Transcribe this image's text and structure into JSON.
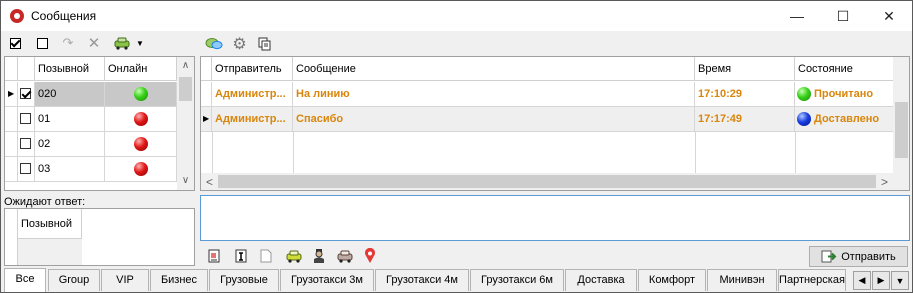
{
  "window": {
    "title": "Сообщения"
  },
  "left_toolbar": {
    "icons": [
      "check-all-icon",
      "uncheck-all-icon",
      "redo-icon",
      "delete-icon",
      "car-icon",
      "dropdown-icon"
    ]
  },
  "drivers": {
    "columns": [
      "Позывной",
      "Онлайн"
    ],
    "rows": [
      {
        "callsign": "020",
        "checked": true,
        "online": "green",
        "selected": true
      },
      {
        "callsign": "01",
        "checked": false,
        "online": "red"
      },
      {
        "callsign": "02",
        "checked": false,
        "online": "red"
      },
      {
        "callsign": "03",
        "checked": false,
        "online": "red"
      }
    ]
  },
  "awaiting": {
    "label": "Ожидают ответ:",
    "column": "Позывной"
  },
  "right_toolbar": {
    "icons": [
      "chat-icon",
      "gear-icon",
      "copy-icon"
    ]
  },
  "messages": {
    "columns": [
      "Отправитель",
      "Сообщение",
      "Время",
      "Состояние"
    ],
    "rows": [
      {
        "sender": "Администр...",
        "message": "На линию",
        "time": "17:10:29",
        "status": "Прочитано",
        "status_color": "green"
      },
      {
        "sender": "Администр...",
        "message": "Спасибо",
        "time": "17:17:49",
        "status": "Доставлено",
        "status_color": "blue"
      }
    ]
  },
  "compose": {
    "value": ""
  },
  "bottom_toolbar": {
    "icons": [
      "template-icon",
      "text-icon",
      "page-icon",
      "taxi-green-icon",
      "driver-icon",
      "taxi-gray-icon",
      "location-pin-icon"
    ]
  },
  "send_button": {
    "label": "Отправить"
  },
  "tabs": [
    "Все",
    "Group",
    "VIP",
    "Бизнес",
    "Грузовые",
    "Грузотакси 3м",
    "Грузотакси 4м",
    "Грузотакси 6м",
    "Доставка",
    "Комфорт",
    "Минивэн",
    "Партнерская"
  ],
  "colors": {
    "accent_orange": "#d9860c",
    "online": "#38d11a",
    "offline": "#e01818",
    "delivered": "#1a3ee0"
  }
}
